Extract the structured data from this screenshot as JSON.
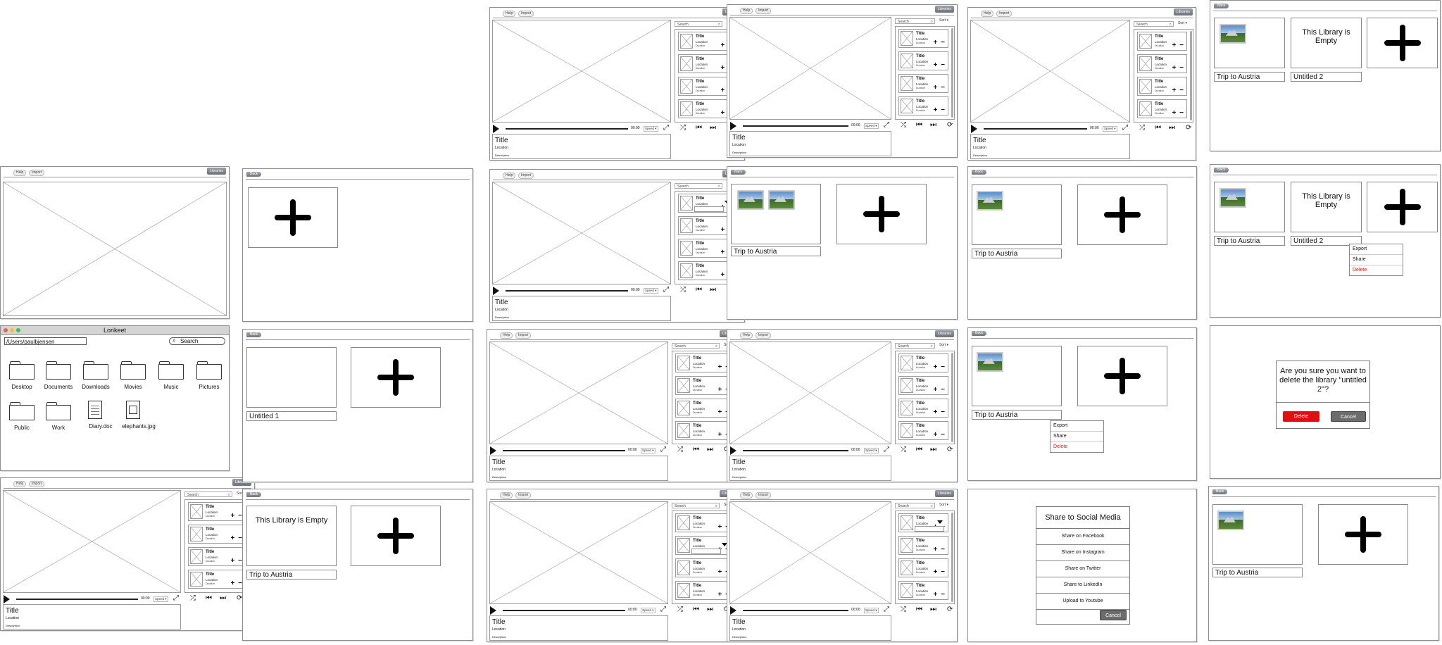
{
  "toolbar": {
    "help": "Help",
    "import": "Import",
    "libraries": "Libraries",
    "back": "Back"
  },
  "search": {
    "placeholder": "Search",
    "sort": "Sort"
  },
  "player": {
    "time": "00:00",
    "speed": "Speed"
  },
  "media_item": {
    "title": "Title",
    "location": "Location",
    "duration": "Duration",
    "plus_minus": "+ −"
  },
  "info": {
    "title": "Title",
    "location": "Location",
    "description": "Description"
  },
  "finder": {
    "title": "Lorikeet",
    "path": "/Users/paulbjensen",
    "search": "Search",
    "items": [
      {
        "label": "Desktop",
        "kind": "folder"
      },
      {
        "label": "Documents",
        "kind": "folder"
      },
      {
        "label": "Downloads",
        "kind": "folder"
      },
      {
        "label": "Movies",
        "kind": "folder"
      },
      {
        "label": "Music",
        "kind": "folder"
      },
      {
        "label": "Pictures",
        "kind": "folder"
      },
      {
        "label": "Public",
        "kind": "folder"
      },
      {
        "label": "Work",
        "kind": "folder"
      },
      {
        "label": "Diary.doc",
        "kind": "document"
      },
      {
        "label": "elephants.jpg",
        "kind": "image-file"
      }
    ]
  },
  "libraries": {
    "untitled1": "Untitled 1",
    "untitled2": "Untitled 2",
    "trip": "Trip to Austria",
    "empty_msg": "This Library is Empty"
  },
  "context_menu": {
    "export": "Export",
    "share": "Share",
    "delete": "Delete"
  },
  "share_dialog": {
    "title": "Share to Social Media",
    "options": [
      "Share on Facebook",
      "Share on Instagram",
      "Share on Twitter",
      "Share to LinkedIn",
      "Upload to Youtube"
    ],
    "cancel": "Cancel"
  },
  "delete_dialog": {
    "question": "Are you sure you want to delete the library \"untitled 2\"?",
    "delete": "Delete",
    "cancel": "Cancel"
  },
  "colors": {
    "danger": "#e01010",
    "accent_button": "#6c7278",
    "frame_border": "#8e8e8e"
  }
}
